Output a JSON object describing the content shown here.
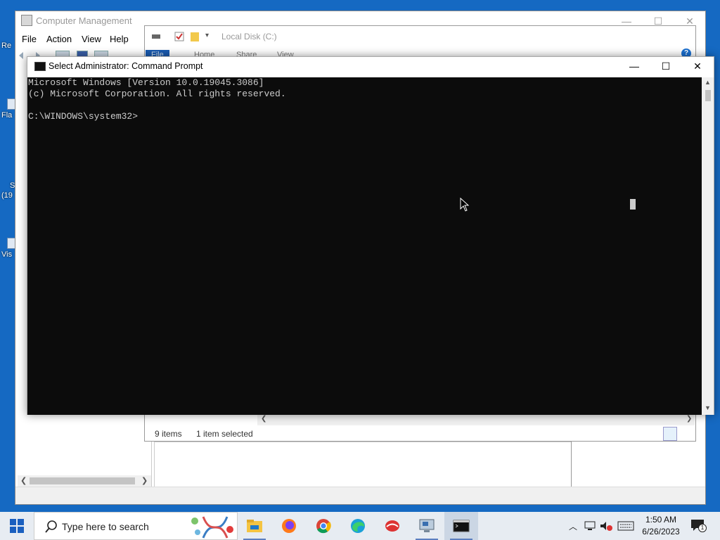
{
  "desktop": {
    "icon_labels": [
      "Re",
      "Fla",
      "S",
      "(19",
      "Vis"
    ]
  },
  "computer_management": {
    "title": "Computer Management",
    "menu": [
      "File",
      "Action",
      "View",
      "Help"
    ],
    "controls": {
      "minimize": "—",
      "maximize": "☐",
      "close": "✕"
    }
  },
  "explorer": {
    "title": "Local Disk (C:)",
    "ribbon_tabs": [
      "File",
      "Home",
      "Share",
      "View"
    ],
    "status_items": "9 items",
    "status_selected": "1 item selected",
    "help": "?"
  },
  "cmd": {
    "title": "Select Administrator:  Command Prompt",
    "lines": [
      "Microsoft Windows [Version 10.0.19045.3086]",
      "(c) Microsoft Corporation. All rights reserved.",
      "",
      "C:\\WINDOWS\\system32>"
    ],
    "controls": {
      "minimize": "—",
      "maximize": "☐",
      "close": "✕"
    }
  },
  "taskbar": {
    "search_placeholder": "Type here to search",
    "apps": [
      "file-explorer",
      "firefox",
      "chrome",
      "edge",
      "app-red",
      "computer-management",
      "command-prompt"
    ],
    "time": "1:50 AM",
    "date": "6/26/2023",
    "notification_count": "1"
  }
}
